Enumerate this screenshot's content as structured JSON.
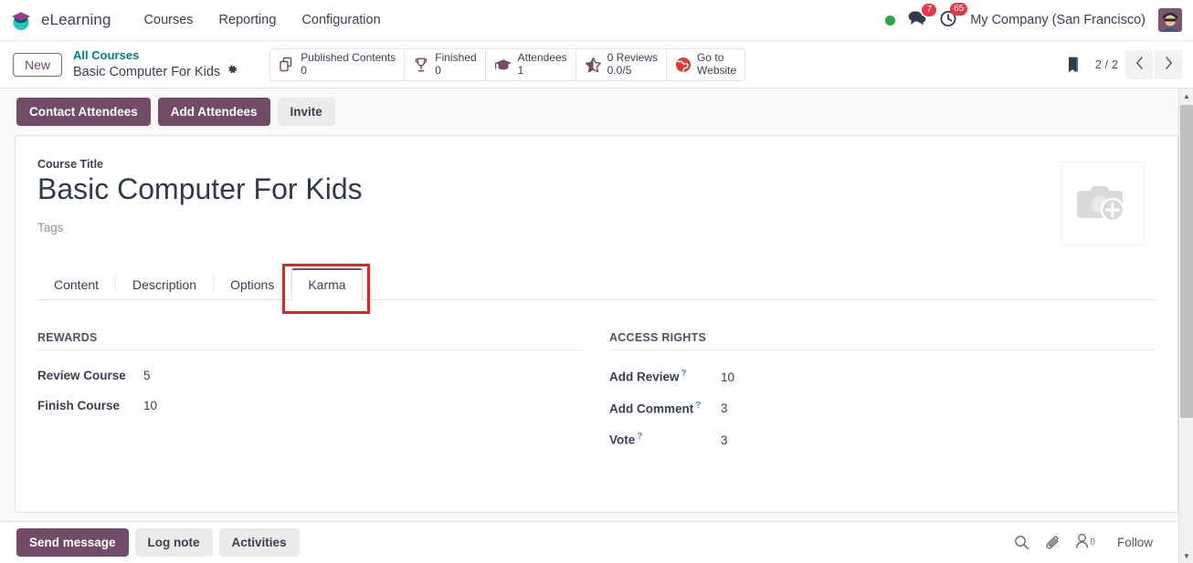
{
  "navbar": {
    "brand": "eLearning",
    "logo_icon": "graduation-cap-icon",
    "menu": [
      {
        "label": "Courses"
      },
      {
        "label": "Reporting"
      },
      {
        "label": "Configuration"
      }
    ],
    "status_dot": "online-indicator",
    "messages_icon": "comments-icon",
    "messages_count": "7",
    "activities_icon": "clock-icon",
    "activities_count": "65",
    "company": "My Company (San Francisco)",
    "avatar_alt": "user-avatar"
  },
  "control_panel": {
    "new_label": "New",
    "breadcrumb_parent": "All Courses",
    "breadcrumb_current": "Basic Computer For Kids",
    "gear_icon": "gear-icon",
    "stats": [
      {
        "icon": "copy-icon",
        "line1": "Published Contents",
        "line2": "0"
      },
      {
        "icon": "trophy-icon",
        "line1": "Finished",
        "line2": "0"
      },
      {
        "icon": "graduation-icon",
        "line1": "Attendees",
        "line2": "1"
      },
      {
        "icon": "star-icon",
        "line1": "0 Reviews",
        "line2": "0.0/5"
      },
      {
        "icon": "globe-icon",
        "line1": "Go to",
        "line2": "Website"
      }
    ],
    "ribbon_icon": "bookmark-icon",
    "pager_text": "2 / 2",
    "prev_icon": "chevron-left-icon",
    "next_icon": "chevron-right-icon"
  },
  "action_bar": {
    "buttons": [
      {
        "label": "Contact Attendees",
        "style": "primary"
      },
      {
        "label": "Add Attendees",
        "style": "primary"
      },
      {
        "label": "Invite",
        "style": "secondary"
      }
    ]
  },
  "form": {
    "title_label": "Course Title",
    "title_value": "Basic Computer For Kids",
    "tags_label": "Tags",
    "image_placeholder_icon": "camera-plus-icon"
  },
  "notebook": {
    "tabs": [
      {
        "label": "Content",
        "active": false
      },
      {
        "label": "Description",
        "active": false
      },
      {
        "label": "Options",
        "active": false
      },
      {
        "label": "Karma",
        "active": true
      }
    ],
    "highlight_tab": "Karma",
    "highlight_color": "#f01e1e"
  },
  "karma": {
    "rewards": {
      "title": "Rewards",
      "fields": [
        {
          "label": "Review Course",
          "value": "5",
          "tooltip": false
        },
        {
          "label": "Finish Course",
          "value": "10",
          "tooltip": false
        }
      ]
    },
    "access_rights": {
      "title": "Access Rights",
      "fields": [
        {
          "label": "Add Review",
          "value": "10",
          "tooltip": true
        },
        {
          "label": "Add Comment",
          "value": "3",
          "tooltip": true
        },
        {
          "label": "Vote",
          "value": "3",
          "tooltip": true
        }
      ]
    },
    "tooltip_marker": "?"
  },
  "chatter": {
    "buttons": [
      {
        "label": "Send message",
        "style": "primary"
      },
      {
        "label": "Log note",
        "style": "secondary"
      },
      {
        "label": "Activities",
        "style": "secondary"
      }
    ],
    "search_icon": "search-icon",
    "attachment_icon": "paperclip-icon",
    "followers_icon": "user-icon",
    "followers_count": "0",
    "follow_label": "Follow"
  },
  "theme": {
    "primary": "#714b67",
    "link": "#017e84",
    "badge": "#e6384a",
    "online": "#28a745"
  }
}
